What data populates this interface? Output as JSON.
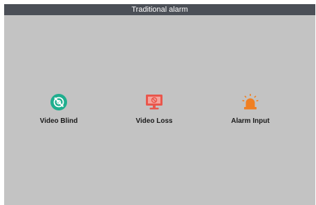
{
  "window": {
    "title": "Traditional alarm"
  },
  "options": [
    {
      "label": "Video Blind",
      "icon": "video-blind-icon",
      "color": "#1fae8e"
    },
    {
      "label": "Video Loss",
      "icon": "video-loss-icon",
      "color": "#e9564c"
    },
    {
      "label": "Alarm Input",
      "icon": "alarm-light-icon",
      "color": "#f07f22"
    }
  ],
  "colors": {
    "titlebar": "#4b4f57",
    "background": "#c3c3c3"
  }
}
